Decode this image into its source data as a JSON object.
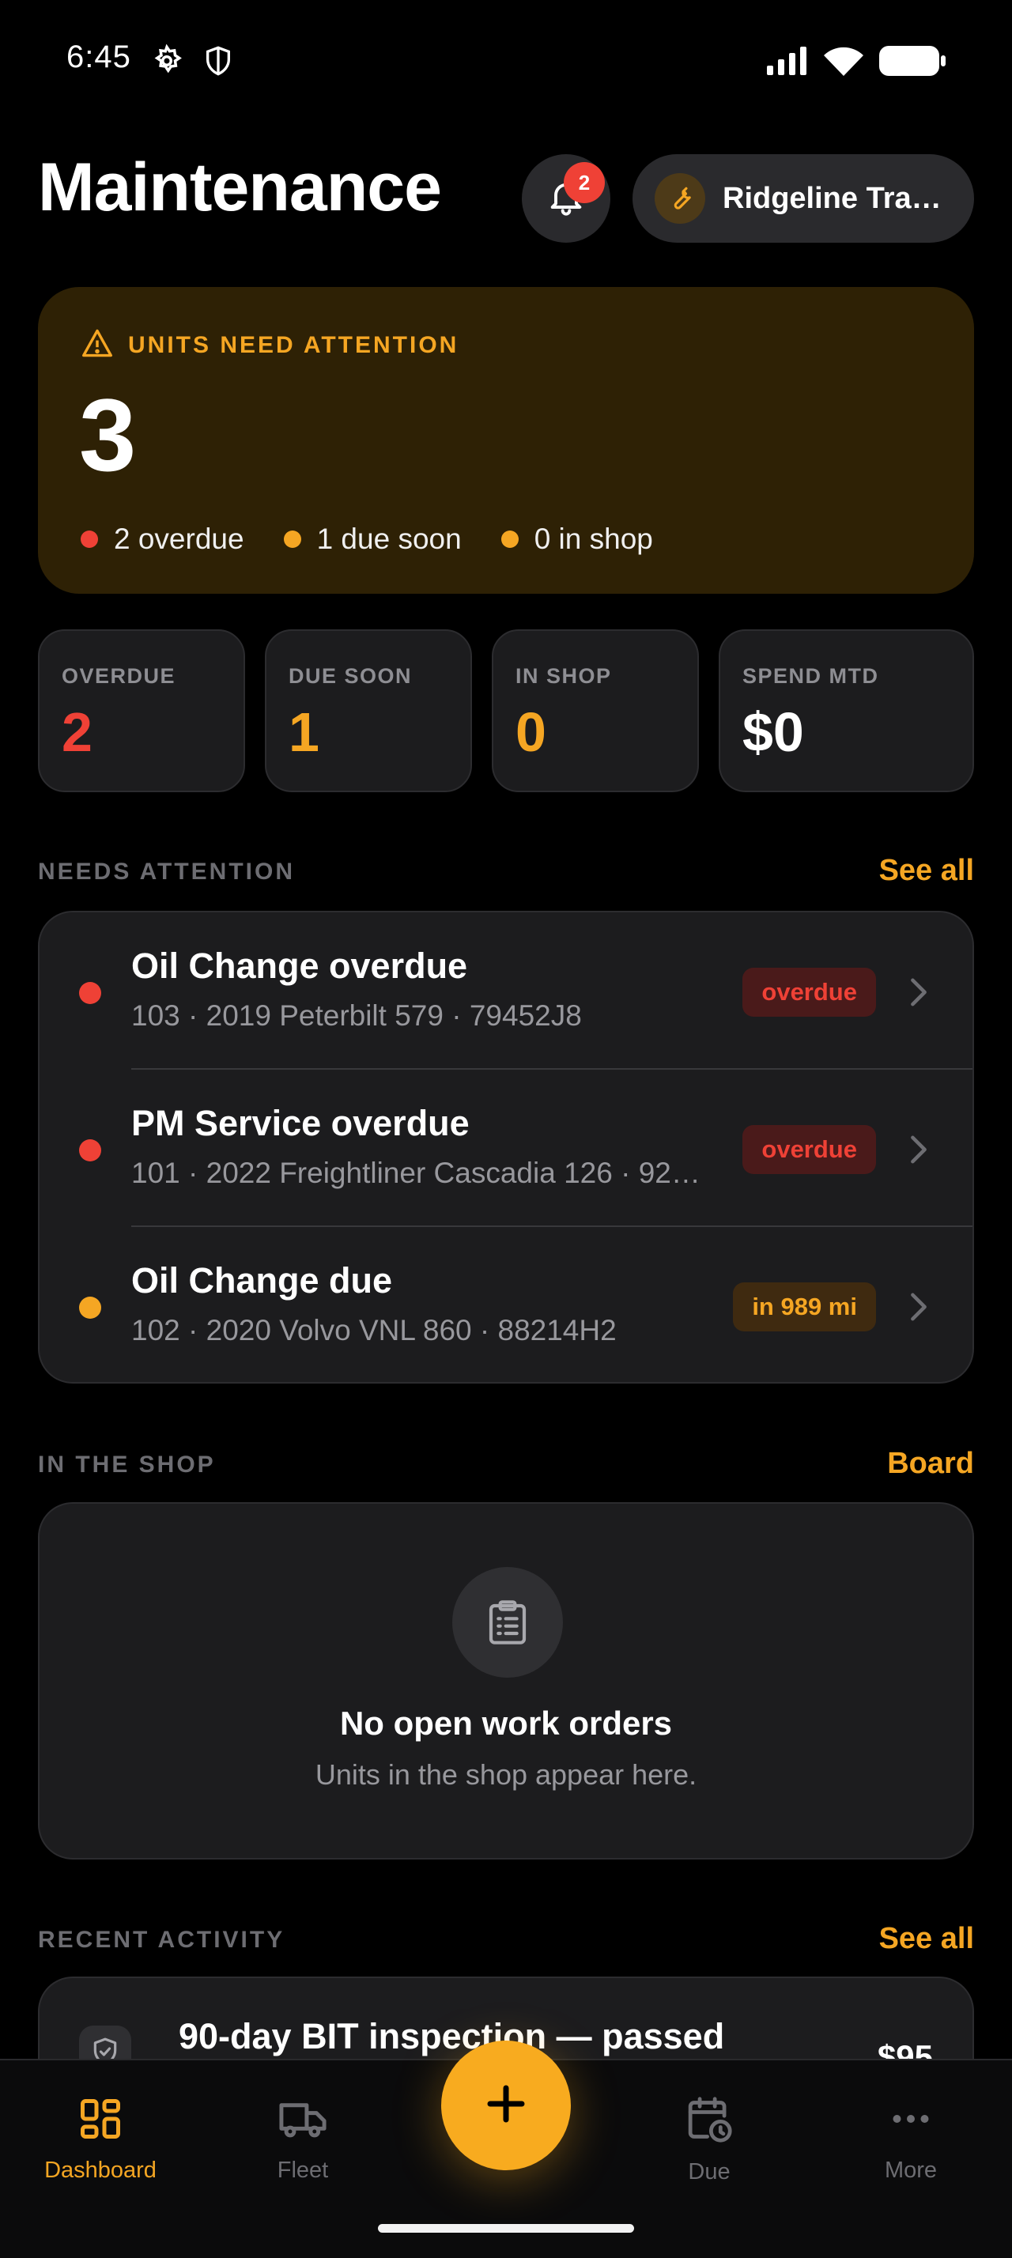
{
  "status_bar": {
    "time": "6:45"
  },
  "header": {
    "title": "Maintenance",
    "notification_count": "2",
    "org_name": "Ridgeline Tra…"
  },
  "hero": {
    "label": "UNITS NEED ATTENTION",
    "count": "3",
    "stats": [
      {
        "text": "2 overdue",
        "color": "#ef4136"
      },
      {
        "text": "1 due soon",
        "color": "#f5a623"
      },
      {
        "text": "0 in shop",
        "color": "#f5a623"
      }
    ]
  },
  "metrics": [
    {
      "label": "OVERDUE",
      "value": "2",
      "color": "#ef4136"
    },
    {
      "label": "DUE SOON",
      "value": "1",
      "color": "#f5a623"
    },
    {
      "label": "IN SHOP",
      "value": "0",
      "color": "#f5a623"
    },
    {
      "label": "SPEND MTD",
      "value": "$0",
      "color": "#ffffff"
    }
  ],
  "needs_attention": {
    "title": "NEEDS ATTENTION",
    "link": "See all",
    "items": [
      {
        "title": "Oil Change overdue",
        "subtitle": "103 · 2019 Peterbilt 579 · 79452J8",
        "badge": "overdue",
        "status": "overdue"
      },
      {
        "title": "PM Service overdue",
        "subtitle": "101 · 2022 Freightliner Cascadia 126 · 92…",
        "badge": "overdue",
        "status": "overdue"
      },
      {
        "title": "Oil Change due",
        "subtitle": "102 · 2020 Volvo VNL 860 · 88214H2",
        "badge": "in 989 mi",
        "status": "due"
      }
    ]
  },
  "in_the_shop": {
    "title": "IN THE SHOP",
    "link": "Board",
    "empty_title": "No open work orders",
    "empty_subtitle": "Units in the shop appear here."
  },
  "recent_activity": {
    "title": "RECENT ACTIVITY",
    "link": "See all",
    "items": [
      {
        "title": "90-day BIT inspection — passed",
        "amount": "$95"
      }
    ]
  },
  "tabs": [
    {
      "label": "Dashboard",
      "icon": "dashboard-icon",
      "active": true
    },
    {
      "label": "Fleet",
      "icon": "truck-icon",
      "active": false
    },
    {
      "label": "Due",
      "icon": "calendar-clock-icon",
      "active": false
    },
    {
      "label": "More",
      "icon": "more-icon",
      "active": false
    }
  ],
  "colors": {
    "accent": "#f5a623",
    "danger": "#ef4136"
  }
}
